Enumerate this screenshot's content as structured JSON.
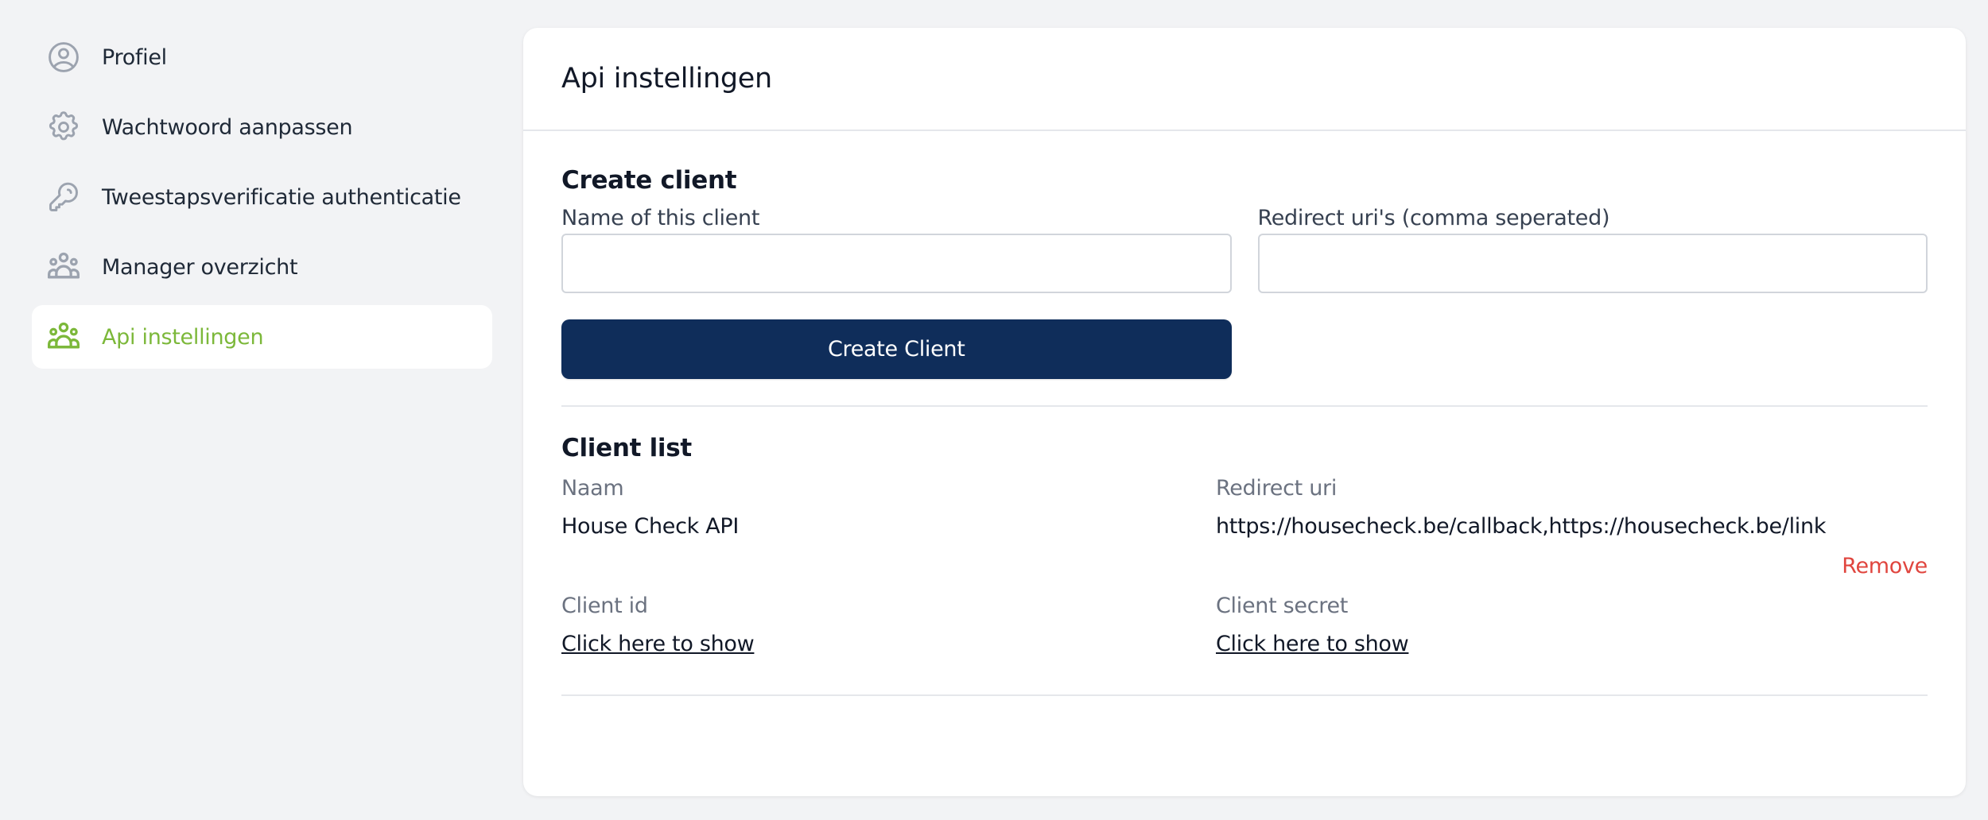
{
  "sidebar": {
    "items": [
      {
        "label": "Profiel",
        "icon": "user-circle-icon",
        "active": false
      },
      {
        "label": "Wachtwoord aanpassen",
        "icon": "gear-icon",
        "active": false
      },
      {
        "label": "Tweestapsverificatie authenticatie",
        "icon": "key-icon",
        "active": false
      },
      {
        "label": "Manager overzicht",
        "icon": "user-group-icon",
        "active": false
      },
      {
        "label": "Api instellingen",
        "icon": "user-group-icon",
        "active": true
      }
    ]
  },
  "colors": {
    "accent": "#7cb83a",
    "primary_button": "#0f2d5a",
    "danger": "#e0453e",
    "background": "#f2f3f5"
  },
  "card": {
    "title": "Api instellingen",
    "create": {
      "title": "Create client",
      "name_label": "Name of this client",
      "name_value": "",
      "redirect_label": "Redirect uri's (comma seperated)",
      "redirect_value": "",
      "submit_label": "Create Client"
    },
    "list": {
      "title": "Client list",
      "clients": [
        {
          "name_label": "Naam",
          "name": "House Check API",
          "redirect_label": "Redirect uri",
          "redirect": "https://housecheck.be/callback,https://housecheck.be/link",
          "remove_label": "Remove",
          "client_id_label": "Client id",
          "client_id_link": "Click here to show",
          "client_secret_label": "Client secret",
          "client_secret_link": "Click here to show"
        }
      ]
    }
  }
}
